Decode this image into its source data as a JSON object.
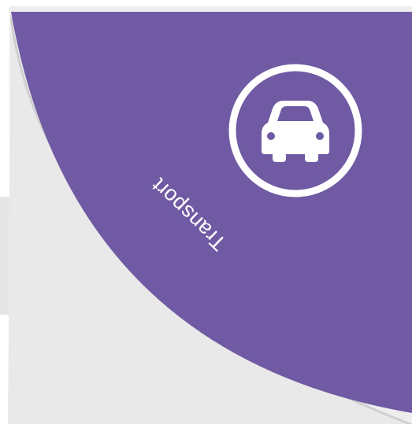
{
  "segment": {
    "label": "Transport",
    "icon": "car-icon",
    "color": "#6f5aa3"
  },
  "colors": {
    "background": "#eeeeee",
    "shadow": "#cfcfcf",
    "icon_stroke": "#ffffff"
  }
}
